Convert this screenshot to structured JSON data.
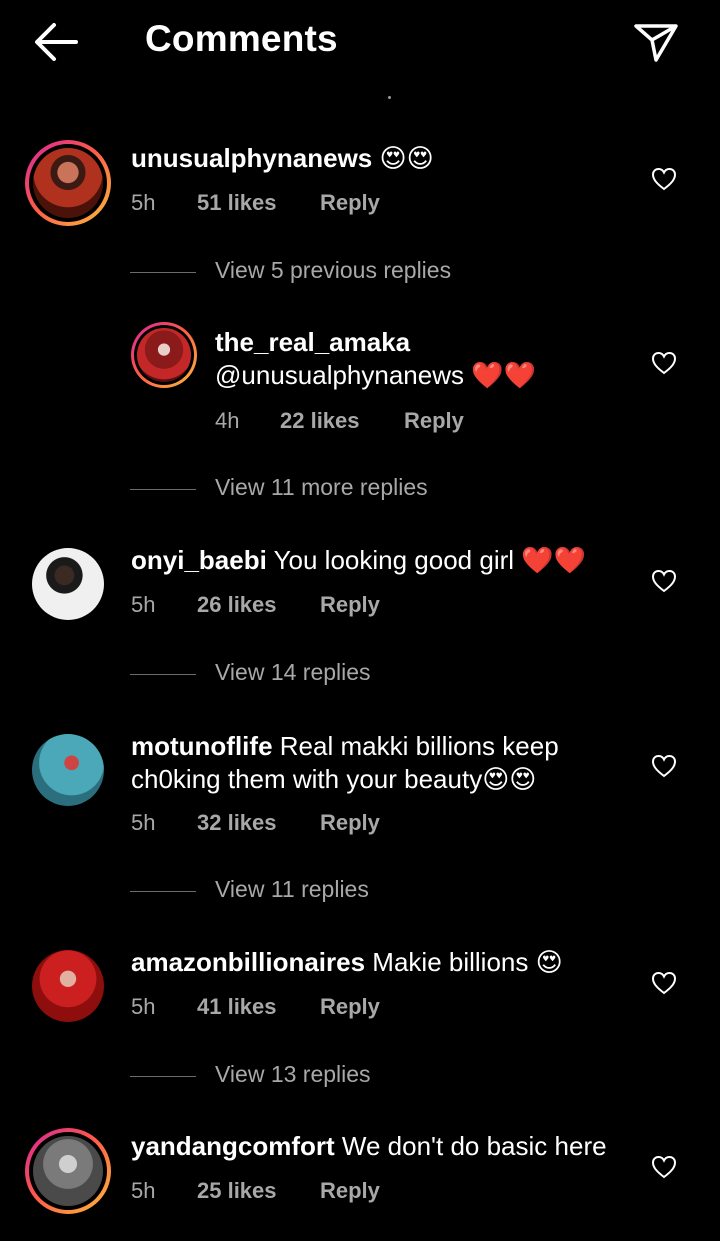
{
  "header": {
    "title": "Comments"
  },
  "icons": {
    "back": "back-arrow-icon",
    "send": "send-paper-plane-icon",
    "heart": "heart-outline-icon"
  },
  "colors": {
    "background": "#000000",
    "muted": "#a8a8a8",
    "story_ring": "#fd5949",
    "emoji_heart": "#e0202e",
    "emoji_face": "#f6c130"
  },
  "comments": [
    {
      "user": "unusualphynanews",
      "text": " 😍😍",
      "time": "5h",
      "likes": "51 likes",
      "reply": "Reply",
      "view_replies": "View 5 previous replies"
    },
    {
      "user": "the_real_amaka",
      "text": "@unusualphynanews ❤️❤️",
      "time": "4h",
      "likes": "22 likes",
      "reply": "Reply",
      "view_replies": "View 11 more replies"
    },
    {
      "user": "onyi_baebi",
      "text": " You looking good girl ❤️❤️",
      "time": "5h",
      "likes": "26 likes",
      "reply": "Reply",
      "view_replies": "View 14 replies"
    },
    {
      "user": "motunoflife",
      "text": " Real makki billions keep ch0king them with your beauty😍😍",
      "time": "5h",
      "likes": "32 likes",
      "reply": "Reply",
      "view_replies": "View 11 replies"
    },
    {
      "user": "amazonbillionaires",
      "text": " Makie billions 😍",
      "time": "5h",
      "likes": "41 likes",
      "reply": "Reply",
      "view_replies": "View 13 replies"
    },
    {
      "user": "yandangcomfort",
      "text": " We don't do basic here",
      "time": "5h",
      "likes": "25 likes",
      "reply": "Reply"
    }
  ]
}
